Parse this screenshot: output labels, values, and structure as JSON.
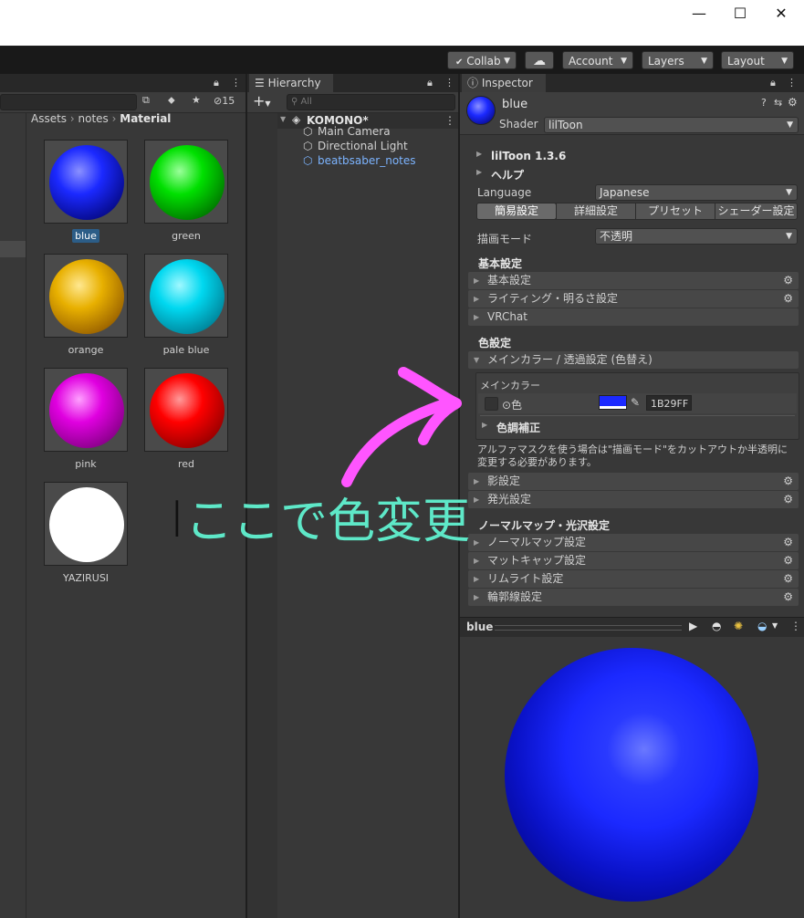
{
  "window": {
    "minimize": "—",
    "maximize": "☐",
    "close": "✕"
  },
  "toolbar": {
    "collab": "Collab",
    "cloud": "☁",
    "account": "Account",
    "layers": "Layers",
    "layout": "Layout"
  },
  "project": {
    "hidden_count": "15",
    "breadcrumb": [
      "Assets",
      "notes",
      "Material"
    ],
    "materials": [
      {
        "name": "blue",
        "color": "#1b29ff",
        "selected": true
      },
      {
        "name": "green",
        "color": "#00e000"
      },
      {
        "name": "orange",
        "color": "#e8b000"
      },
      {
        "name": "pale blue",
        "color": "#00d8f0"
      },
      {
        "name": "pink",
        "color": "#e000e0"
      },
      {
        "name": "red",
        "color": "#ff0000"
      },
      {
        "name": "YAZIRUSI",
        "color": "#ffffff"
      }
    ]
  },
  "hierarchy": {
    "tab": "Hierarchy",
    "search_placeholder": "All",
    "scene": "KOMONO*",
    "items": [
      "Main Camera",
      "Directional Light",
      "beatbsaber_notes"
    ]
  },
  "inspector": {
    "tab": "Inspector",
    "material_name": "blue",
    "shader_label": "Shader",
    "shader_value": "lilToon",
    "liltoon_version": "lilToon 1.3.6",
    "help": "ヘルプ",
    "language_label": "Language",
    "language_value": "Japanese",
    "tabs": [
      "簡易設定",
      "詳細設定",
      "プリセット",
      "シェーダー設定"
    ],
    "render_mode_label": "描画モード",
    "render_mode_value": "不透明",
    "basic_header": "基本設定",
    "basic_sections": [
      "基本設定",
      "ライティング・明るさ設定",
      "VRChat"
    ],
    "color_header": "色設定",
    "main_color_section": "メインカラー / 透過設定 (色替え)",
    "main_color_title": "メインカラー",
    "color_label": "⊙色",
    "color_hex": "1B29FF",
    "color_adjust": "色調補正",
    "alpha_note": "アルファマスクを使う場合は\"描画モード\"をカットアウトか半透明に変更する必要があります。",
    "color_sections": [
      "影設定",
      "発光設定"
    ],
    "normal_header": "ノーマルマップ・光沢設定",
    "normal_sections": [
      "ノーマルマップ設定",
      "マットキャップ設定",
      "リムライト設定",
      "輪郭線設定"
    ],
    "preview_name": "blue"
  },
  "annotation": {
    "cursor": "I",
    "text": "ここで色変更",
    "text_color": "#5ee8c8",
    "arrow_color": "#ff55ff"
  }
}
